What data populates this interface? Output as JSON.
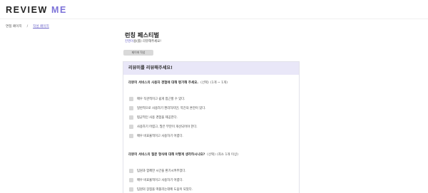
{
  "header": {
    "logo_part1": "REVIEW",
    "logo_part2": "ME"
  },
  "breadcrumb": {
    "home": "면접 페이지",
    "separator": "/",
    "current": "작성 페이지"
  },
  "form": {
    "title": "런칭 페스티벌",
    "nickname": "진영이",
    "subtitle_rest": "용(를) 리뷰해주세요!",
    "reset_button": "제이에 작성"
  },
  "card": {
    "header": "리뷰미를 리뷰해주세요!",
    "questions": [
      {
        "text": "리뷰미 서비스의 사용자 경험에 대해 평가해 주세요.",
        "type_note": "(선택)",
        "count_note": "(1개 ~ 1개)",
        "options": [
          "매우 직관적이고 쉽게 접근할 수 있다.",
          "일반적으로 사용하기 편리하지만, 약간의 혼란이 있다.",
          "평균적인 사용 경험을 제공한다.",
          "사용하기 어렵고, 많은 부분이 개선되어야 한다.",
          "매우 비효율적이고 사용하기 어렵다."
        ]
      },
      {
        "text": "리뷰미 서비스의 질문 형식에 대해 어떻게 생각하시나요?",
        "type_note": "(선택)",
        "count_note": "(최소 1개 이상)",
        "options": [
          "팀원과 함께한 시간을 환기시켜주었다.",
          "매우 비효율적이고 사용하기 어렵다.",
          "팀원의 장점을 떠올리는데에 도움이 되었다."
        ]
      }
    ]
  }
}
